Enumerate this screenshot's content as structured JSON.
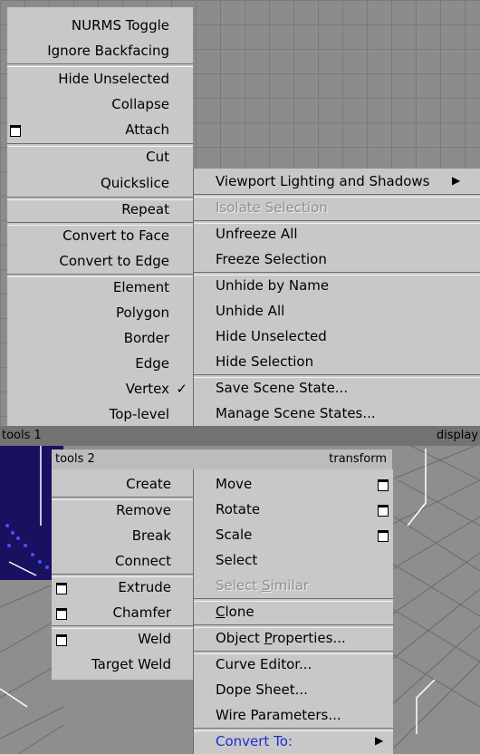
{
  "quad_top_left": {
    "items": [
      {
        "label": "NURMS Toggle"
      },
      {
        "label": "Ignore Backfacing"
      },
      {
        "label": "Hide Unselected"
      },
      {
        "label": "Collapse"
      },
      {
        "label": "Attach",
        "option_box": true
      },
      {
        "label": "Cut"
      },
      {
        "label": "Quickslice"
      },
      {
        "label": "Repeat"
      },
      {
        "label": "Convert to Face"
      },
      {
        "label": "Convert to Edge"
      },
      {
        "label": "Element"
      },
      {
        "label": "Polygon"
      },
      {
        "label": "Border"
      },
      {
        "label": "Edge"
      },
      {
        "label": "Vertex",
        "checked": true
      },
      {
        "label": "Top-level"
      }
    ],
    "checkmark": "✓",
    "title": "tools 1"
  },
  "quad_top_right": {
    "items": [
      {
        "label": "Viewport Lighting and Shadows",
        "submenu": true
      },
      {
        "label": "Isolate Selection",
        "disabled": true
      },
      {
        "label": "Unfreeze All"
      },
      {
        "label": "Freeze Selection"
      },
      {
        "label": "Unhide by Name"
      },
      {
        "label": "Unhide All"
      },
      {
        "label": "Hide Unselected"
      },
      {
        "label": "Hide Selection"
      },
      {
        "label": "Save Scene State..."
      },
      {
        "label": "Manage Scene States..."
      }
    ],
    "submenu_arrow": "▶",
    "title": "display"
  },
  "quad_bottom_left": {
    "title": "tools 2",
    "items": [
      {
        "label": "Create"
      },
      {
        "label": "Remove"
      },
      {
        "label": "Break"
      },
      {
        "label": "Connect"
      },
      {
        "label": "Extrude",
        "option_box": true
      },
      {
        "label": "Chamfer",
        "option_box": true
      },
      {
        "label": "Weld",
        "option_box": true
      },
      {
        "label": "Target Weld"
      }
    ]
  },
  "quad_bottom_right": {
    "title": "transform",
    "items": [
      {
        "label": "Move",
        "option_box": true
      },
      {
        "label": "Rotate",
        "option_box": true
      },
      {
        "label": "Scale",
        "option_box": true
      },
      {
        "label": "Select"
      },
      {
        "label_pre": "Select ",
        "label_u": "S",
        "label_post": "imilar",
        "disabled": true
      },
      {
        "label_pre": "",
        "label_u": "C",
        "label_post": "lone"
      },
      {
        "label_pre": "Object ",
        "label_u": "P",
        "label_post": "roperties..."
      },
      {
        "label": "Curve Editor..."
      },
      {
        "label": "Dope Sheet..."
      },
      {
        "label": "Wire Parameters..."
      },
      {
        "label": "Convert To:",
        "submenu": true,
        "highlight": true
      }
    ],
    "submenu_arrow": "▶"
  },
  "colors": {
    "menu_bg": "#c8c8c8",
    "title_bar": "#737373",
    "convert_to_text": "#1e2cd6",
    "viewport_dark": "#1a1060",
    "viewport_grey": "#8c8c8c"
  }
}
